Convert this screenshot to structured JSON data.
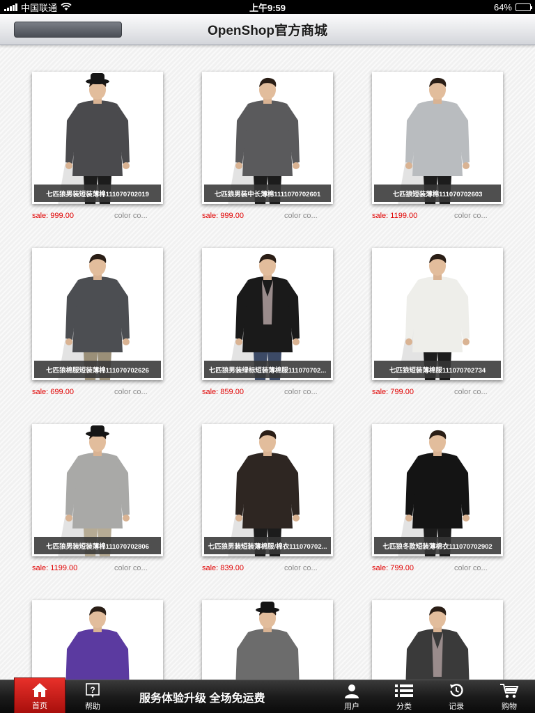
{
  "status_bar": {
    "carrier": "中国联通",
    "time": "上午9:59",
    "battery_percent": "64%",
    "battery_level": 0.64
  },
  "nav": {
    "title": "OpenShop官方商城",
    "search_value": "",
    "search_icon": "magnifier-icon"
  },
  "product_labels": {
    "price_prefix": "sale: ",
    "color_label": "color co..."
  },
  "products": [
    {
      "name": "七匹狼男装短装薄棉111070702019",
      "price": "999.00",
      "look": {
        "garment": "#4a4a4d",
        "pants": "#1c1c1c",
        "hat": true,
        "jacket": false
      }
    },
    {
      "name": "七匹狼男装中长薄棉1111070702601",
      "price": "999.00",
      "look": {
        "garment": "#5a5a5c",
        "pants": "#1c1c1c",
        "hat": false,
        "jacket": false
      }
    },
    {
      "name": "七匹狼短装薄棉111070702603",
      "price": "1199.00",
      "look": {
        "garment": "#b9bcbf",
        "pants": "#1c1c1c",
        "hat": false,
        "jacket": false
      }
    },
    {
      "name": "七匹狼棉服短装薄棉111070702626",
      "price": "699.00",
      "look": {
        "garment": "#4c4e52",
        "pants": "#9a8f78",
        "hat": false,
        "jacket": false
      }
    },
    {
      "name": "七匹狼男装绿标短装薄棉服111070702...",
      "price": "859.00",
      "look": {
        "garment": "#1a1a1a",
        "pants": "#3c4a66",
        "hat": false,
        "jacket": true
      }
    },
    {
      "name": "七匹狼短装薄棉服111070702734",
      "price": "799.00",
      "look": {
        "garment": "#eeeeea",
        "pants": "#1c1c1c",
        "hat": false,
        "jacket": false
      }
    },
    {
      "name": "七匹狼男装短装薄棉111070702806",
      "price": "1199.00",
      "look": {
        "garment": "#a9a9a7",
        "pants": "#b6ab94",
        "hat": true,
        "jacket": false
      }
    },
    {
      "name": "七匹狼男装短装薄棉服/棉衣111070702...",
      "price": "839.00",
      "look": {
        "garment": "#2e2622",
        "pants": "#1c1c1c",
        "hat": false,
        "jacket": false
      }
    },
    {
      "name": "七匹狼冬款短装薄棉衣111070702902",
      "price": "799.00",
      "look": {
        "garment": "#141414",
        "pants": "#1c1c1c",
        "hat": false,
        "jacket": false
      }
    },
    {
      "name": "",
      "price": "",
      "look": {
        "garment": "#5b3aa0",
        "pants": "#1c1c1c",
        "hat": false,
        "jacket": false
      }
    },
    {
      "name": "",
      "price": "",
      "look": {
        "garment": "#6c6c6c",
        "pants": "#1c1c1c",
        "hat": true,
        "jacket": false
      }
    },
    {
      "name": "",
      "price": "",
      "look": {
        "garment": "#3a3a3a",
        "pants": "#1c1c1c",
        "hat": false,
        "jacket": true
      }
    }
  ],
  "tab_bar": {
    "home": "首页",
    "help": "帮助",
    "promo": "服务体验升级 全场免运费",
    "user": "用户",
    "category": "分类",
    "history": "记录",
    "cart": "购物",
    "active_color": "#d4201a"
  }
}
